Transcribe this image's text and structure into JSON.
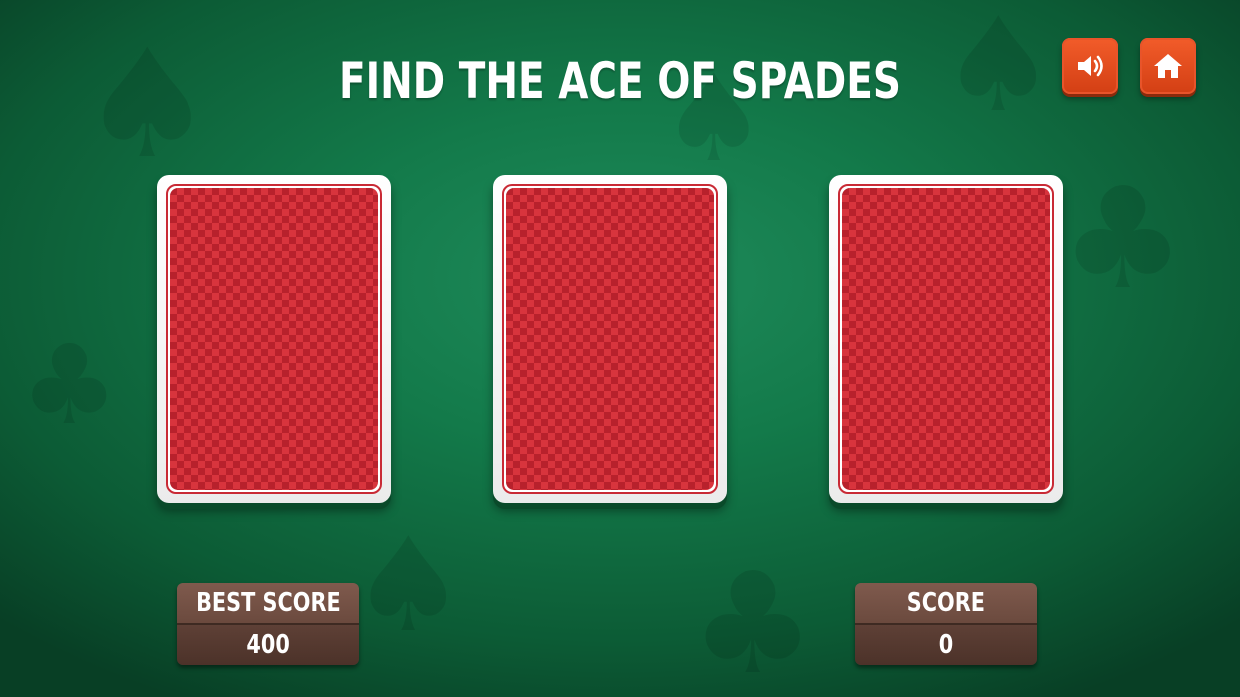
{
  "title": "FIND THE ACE OF SPADES",
  "buttons": {
    "sound": {
      "icon": "speaker-icon"
    },
    "home": {
      "icon": "home-icon"
    }
  },
  "cards": [
    {
      "state": "face-down"
    },
    {
      "state": "face-down"
    },
    {
      "state": "face-down"
    }
  ],
  "best_score": {
    "label": "BEST SCORE",
    "value": "400"
  },
  "score": {
    "label": "SCORE",
    "value": "0"
  },
  "colors": {
    "table_green": "#137a4a",
    "card_red": "#b51621",
    "button_orange": "#e04a1c",
    "panel_brown": "#6b4a3e"
  }
}
